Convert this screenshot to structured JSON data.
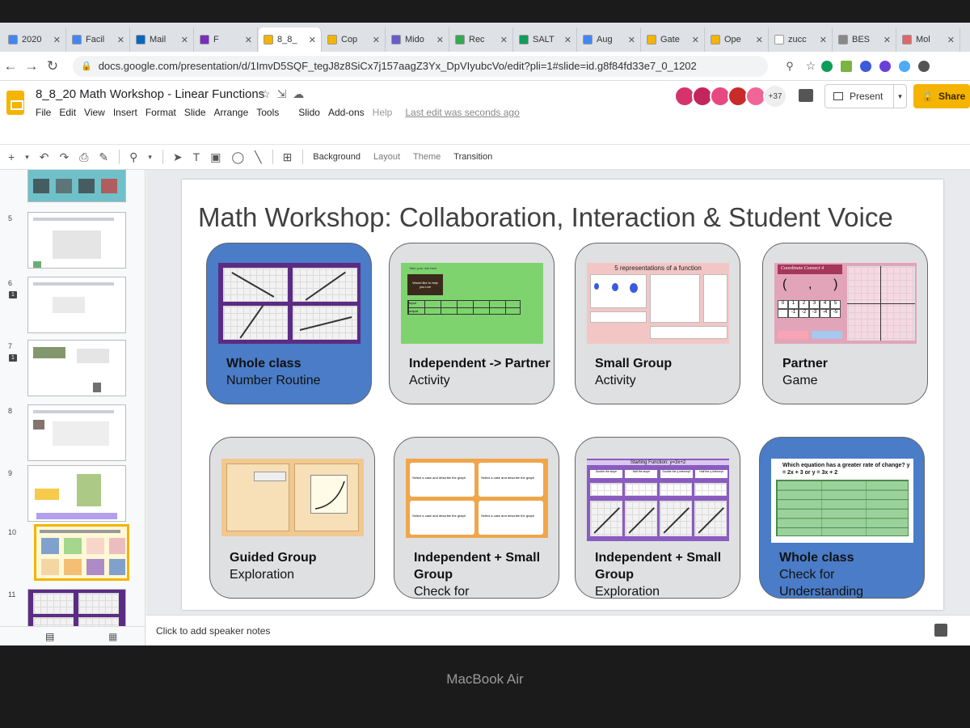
{
  "tabs": [
    {
      "label": "2020",
      "color": "#4285f4"
    },
    {
      "label": "Facil",
      "color": "#4285f4"
    },
    {
      "label": "Mail",
      "color": "#0a66c2"
    },
    {
      "label": "F",
      "color": "#7b2cbf"
    },
    {
      "label": "8_8_",
      "color": "#f4b400",
      "active": true
    },
    {
      "label": "Cop",
      "color": "#f4b400"
    },
    {
      "label": "Mido",
      "color": "#6a5acd"
    },
    {
      "label": "Rec",
      "color": "#34a853"
    },
    {
      "label": "SALT",
      "color": "#0f9d58"
    },
    {
      "label": "Aug",
      "color": "#4285f4"
    },
    {
      "label": "Gate",
      "color": "#f4b400"
    },
    {
      "label": "Ope",
      "color": "#f4b400"
    },
    {
      "label": "zucc",
      "color": "#ffffff"
    },
    {
      "label": "BES",
      "color": "#888888"
    },
    {
      "label": "Mol",
      "color": "#e06666"
    }
  ],
  "tab_close": "✕",
  "url": "docs.google.com/presentation/d/1ImvD5SQF_tegJ8z8SiCx7j157aagZ3Yx_DpVIyubcVo/edit?pli=1#slide=id.g8f84fd33e7_0_1202",
  "doc": {
    "title": "8_8_20 Math Workshop - Linear Functions",
    "menu": [
      "File",
      "Edit",
      "View",
      "Insert",
      "Format",
      "Slide",
      "Arrange",
      "Tools",
      "Slido",
      "Add-ons",
      "Help"
    ],
    "last_edit": "Last edit was seconds ago",
    "extra_users": "+37",
    "present_label": "Present",
    "share_label": "Share"
  },
  "toolbar": {
    "background": "Background",
    "layout": "Layout",
    "theme": "Theme",
    "transition": "Transition"
  },
  "filmstrip": {
    "slide_numbers": [
      "5",
      "6",
      "7",
      "8",
      "9",
      "10",
      "11"
    ],
    "comment_count": "1",
    "selected": "10"
  },
  "slide": {
    "title": "Math Workshop: Collaboration, Interaction & Student Voice",
    "cards": [
      {
        "title": "Whole class",
        "sub": "Number Routine",
        "blue": true
      },
      {
        "title": "Independent -> Partner",
        "sub": "Activity",
        "blue": false,
        "shot_text": [
          "Take your role here",
          "Would like to help you  Lee",
          "Input",
          "output"
        ]
      },
      {
        "title": "Small Group",
        "sub": "Activity",
        "blue": false,
        "shot_title": "5 representations of a function"
      },
      {
        "title": "Partner",
        "sub": "Game",
        "blue": false,
        "shot_title": "Coordinate Connect 4",
        "shot_pair": "(      ,      )",
        "shot_numbers": [
          "0",
          "1",
          "2",
          "3",
          "4",
          "5"
        ],
        "shot_numbers_neg": [
          "-1",
          "-2",
          "-3",
          "-4",
          "-5"
        ]
      },
      {
        "title": "Guided Group",
        "sub": "Exploration",
        "blue": false
      },
      {
        "title": "Independent + Small Group",
        "sub": "Check for Understanding",
        "blue": false,
        "shot_text": "Select a case and describe the graph"
      },
      {
        "title": "Independent + Small Group",
        "sub": "Exploration",
        "blue": false,
        "shot_title": "Starting Function: y=3x+2",
        "shot_cols": [
          "Double the slope",
          "Half the slope",
          "Double the y-intercept",
          "Half the y-intercept"
        ]
      },
      {
        "title": "Whole class",
        "sub": "Check for Understanding",
        "blue": true,
        "shot_title": "Which equation has a greater rate of change?  y = 2x + 3  or y = 3x + 2"
      }
    ]
  },
  "notes_placeholder": "Click to add speaker notes",
  "bezel_label": "MacBook Air",
  "colors": {
    "brand": "#f4b400",
    "card_blue": "#4a7cc7",
    "card_grey": "#dfe0e2",
    "slide_purple": "#5b2c83"
  }
}
